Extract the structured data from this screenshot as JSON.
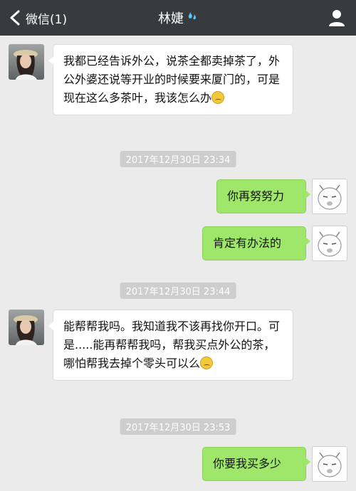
{
  "header": {
    "back_label": "微信(1)",
    "title": "林婕",
    "title_emoji": "💦"
  },
  "messages": [
    {
      "side": "left",
      "text": "我都已经告诉外公，说茶全都卖掉茶了，外公外婆还说等开业的时候要来厦门的，可是现在这么多茶叶，我该怎么办",
      "emoji": "grimace"
    },
    {
      "timestamp": "2017年12月30日 23:34"
    },
    {
      "side": "right",
      "text": "你再努努力"
    },
    {
      "side": "right",
      "text": "肯定有办法的"
    },
    {
      "timestamp": "2017年12月30日 23:44"
    },
    {
      "side": "left",
      "text": "能帮帮我吗。我知道我不该再找你开口。可是.....能再帮帮我吗，帮我买点外公的茶，哪怕帮我去掉个零头可以么",
      "emoji": "grimace"
    },
    {
      "timestamp": "2017年12月30日 23:53"
    },
    {
      "side": "right",
      "text": "你要我买多少"
    }
  ],
  "colors": {
    "header_bg": "#373b3e",
    "chat_bg": "#ebebeb",
    "bubble_right": "#9fe76a",
    "bubble_left": "#ffffff",
    "timestamp_bg": "#cecece"
  }
}
